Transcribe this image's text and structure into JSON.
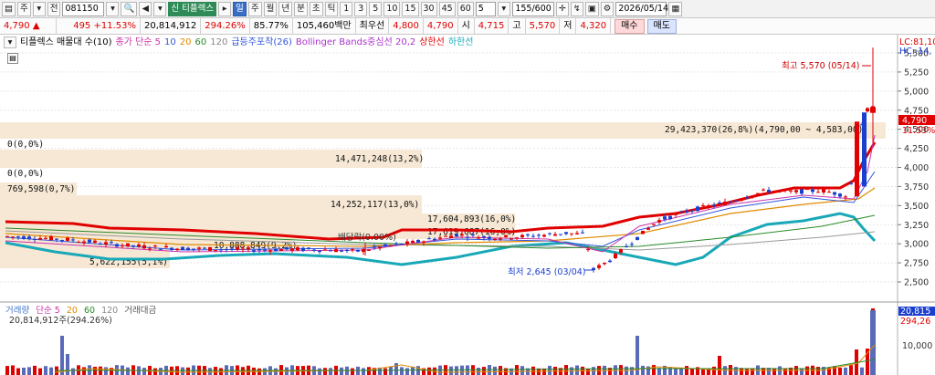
{
  "toolbar": {
    "market": "주",
    "code": "081150",
    "stock_name": "티플렉스",
    "period_buttons": [
      "일",
      "주",
      "월",
      "년",
      "분",
      "초",
      "틱"
    ],
    "interval_buttons": [
      "1",
      "3",
      "5",
      "10",
      "15",
      "30",
      "45",
      "60"
    ],
    "interval_value": "5",
    "count_value": "155/600",
    "date_value": "2026/05/14",
    "selected_period": "일"
  },
  "quote": {
    "price": "4,790",
    "change": "495",
    "change_pct": "+11.53%",
    "volume": "20,814,912",
    "volume_ratio": "294.26%",
    "turnover": "85.77%",
    "amount": "105,460백만",
    "best_ask_label": "최우선",
    "best_ask": "4,800",
    "best_bid": "4,790",
    "open_label": "시",
    "open": "4,715",
    "high_label": "고",
    "high": "5,570",
    "low_label": "저",
    "low": "4,320",
    "buy_label": "매수",
    "sell_label": "매도"
  },
  "legend": {
    "stock": "티플렉스 매물대 수(10)",
    "ma": "종가 단순 5",
    "ma_periods": [
      "10",
      "20",
      "60",
      "120"
    ],
    "pattern": "급등주포착(26)",
    "bollinger": "Bollinger Bands중심선 20,2",
    "upper": "상한선",
    "lower": "하한선"
  },
  "right_header": {
    "lc": "LC:81,10",
    "hc": "HC:-14,"
  },
  "annotations": {
    "high": "최고 5,570 (05/14)",
    "low": "최저 2,645 (03/04)",
    "dividend": "배당락(0.00%)",
    "current_price": "4,790",
    "current_pct": "11.53%"
  },
  "volume_panel": {
    "legend_volume": "거래량",
    "legend_ma": "단순 5",
    "legend_periods": [
      "20",
      "60",
      "120"
    ],
    "legend_amount": "거래대금",
    "current": "20,814,912주(294.26%)",
    "axis_current": "20,815",
    "axis_pct": "294,26",
    "axis_tick": "10,000"
  },
  "chart_data": {
    "type": "candlestick",
    "y_ticks": [
      "5,500",
      "5,250",
      "5,000",
      "4,750",
      "4,500",
      "4,250",
      "4,000",
      "3,750",
      "3,500",
      "3,250",
      "3,000",
      "2,750",
      "2,500"
    ],
    "volume_profile": [
      {
        "label": "29,423,370(26,8%)(4,790,00 ~ 4,583,00)"
      },
      {
        "label": "0(0,0%)"
      },
      {
        "label": "14,471,248(13,2%)"
      },
      {
        "label": "0(0,0%)"
      },
      {
        "label": "769,598(0,7%)"
      },
      {
        "label": "14,252,117(13,0%)"
      },
      {
        "label": "17,604,893(16,0%)"
      },
      {
        "label": "17,619,687(16,0%)"
      },
      {
        "label": "10,888,849(9,2%)"
      },
      {
        "label": "5,622,155(5,1%)"
      }
    ]
  }
}
